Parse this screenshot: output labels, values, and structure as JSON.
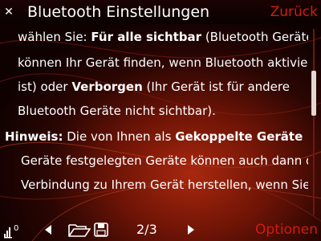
{
  "header": {
    "title": "Bluetooth Einstellungen",
    "back_label": "Zurück"
  },
  "content": {
    "line1_pre": "wählen Sie: ",
    "line1_bold": "Für alle sichtbar",
    "line1_post": " (Bluetooth Geräte",
    "line2": "können Ihr Gerät finden, wenn Bluetooth aktiviert",
    "line3_pre": "ist) oder ",
    "line3_bold": "Verborgen",
    "line3_post": " (Ihr Gerät ist für andere",
    "line4": "Bluetooth Geräte nicht sichtbar).",
    "line5_bold1": "Hinweis:",
    "line5_mid": " Die von Ihnen als ",
    "line5_bold2": "Gekoppelte Geräte",
    "line6": "Geräte festgelegten Geräte können auch dann die",
    "line7": "Verbindung zu Ihrem Gerät herstellen, wenn Sie"
  },
  "toolbar": {
    "text_size_badge": "0",
    "page_indicator": "2/3",
    "options_label": "Optionen"
  },
  "colors": {
    "accent_red": "#d01d0f",
    "text": "#ffffff"
  },
  "icons": [
    "close-icon",
    "text-size-icon",
    "previous-icon",
    "folder-open-icon",
    "save-icon",
    "next-icon"
  ]
}
